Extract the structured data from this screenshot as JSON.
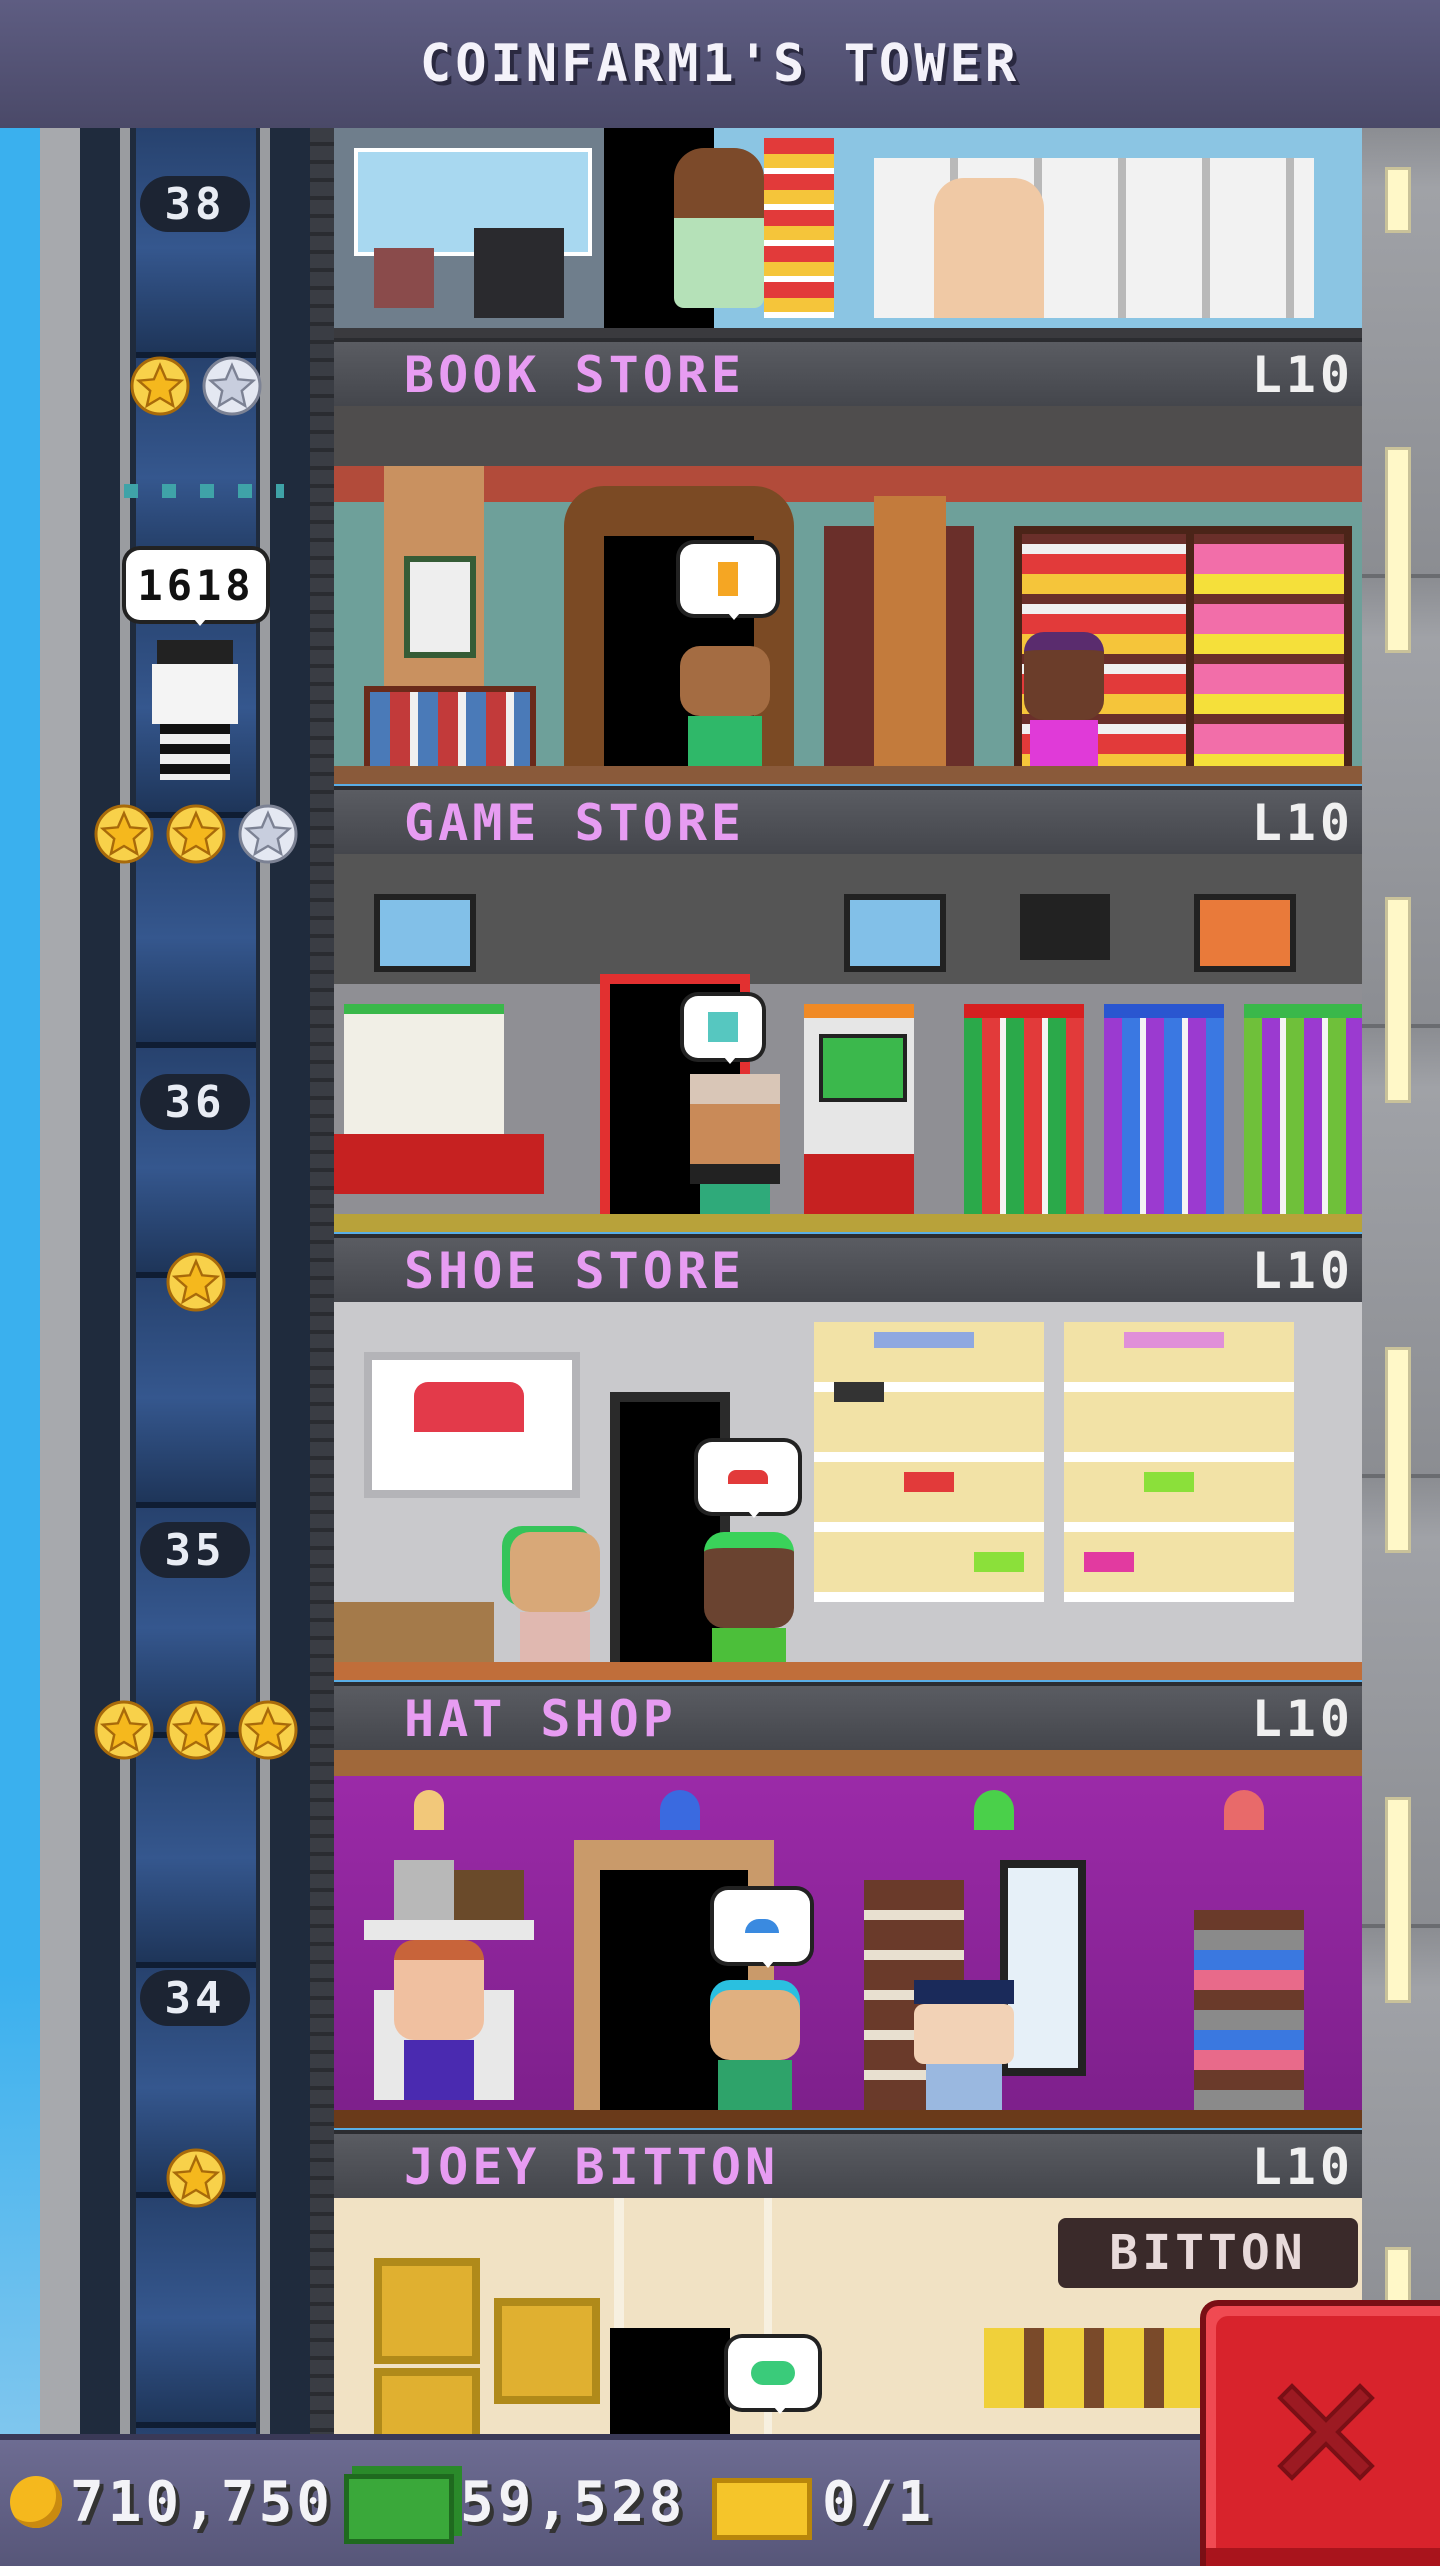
{
  "header": {
    "title": "COINFARM1'S TOWER"
  },
  "elevator": {
    "floor_numbers": [
      "38",
      "36",
      "35",
      "34"
    ],
    "passenger_count": "1618"
  },
  "floors": [
    {
      "name": "BOOK STORE",
      "level": "L10",
      "stars_filled": 1,
      "stars_total": 2
    },
    {
      "name": "GAME STORE",
      "level": "L10",
      "stars_filled": 2,
      "stars_total": 3
    },
    {
      "name": "SHOE STORE",
      "level": "L10",
      "stars_filled": 1,
      "stars_total": 1
    },
    {
      "name": "HAT SHOP",
      "level": "L10",
      "stars_filled": 3,
      "stars_total": 3
    },
    {
      "name": "JOEY BITTON",
      "level": "L10",
      "stars_filled": 1,
      "stars_total": 1
    }
  ],
  "signage": {
    "bitton": "BITTON"
  },
  "status_bar": {
    "coins": "710,750",
    "tower_bux": "59,528",
    "tickets": "0/1"
  },
  "colors": {
    "header": "#5e5d82",
    "store_title": "#e79cf2",
    "close_button": "#d8232c",
    "star_gold": "#f5b81d",
    "star_silver": "#c8cede"
  },
  "icons": {
    "coin": "coin-icon",
    "bux": "tower-bux-icon",
    "ticket": "vip-ticket-icon",
    "close": "close-icon"
  }
}
